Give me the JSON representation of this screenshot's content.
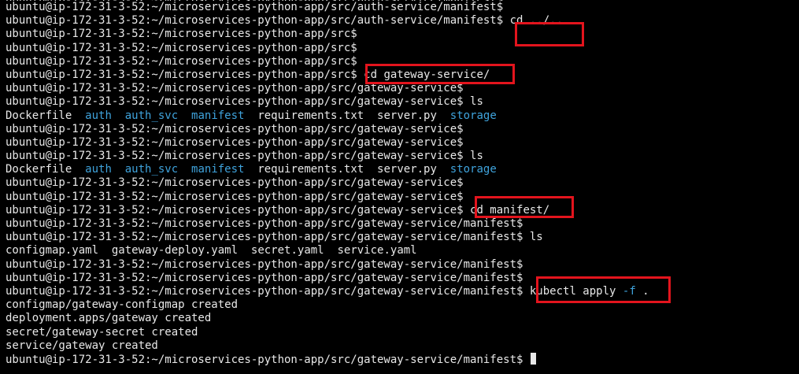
{
  "colors": {
    "background": "#000000",
    "text": "#e8e8e8",
    "directory": "#3fa3dc",
    "highlight": "#e3141d"
  },
  "terminal": {
    "lines": [
      {
        "segments": [
          {
            "t": "ubuntu@ip-172-31-3-52:~/microservices-python-app/src/auth-service/manifest$"
          }
        ],
        "clipped": true
      },
      {
        "segments": [
          {
            "t": "ubuntu@ip-172-31-3-52:~/microservices-python-app/src/auth-service/manifest$"
          }
        ]
      },
      {
        "segments": [
          {
            "t": "ubuntu@ip-172-31-3-52:~/microservices-python-app/src/auth-service/manifest$ "
          },
          {
            "t": "cd ../..",
            "cmd": true
          }
        ]
      },
      {
        "segments": [
          {
            "t": "ubuntu@ip-172-31-3-52:~/microservices-python-app/src$"
          }
        ]
      },
      {
        "segments": [
          {
            "t": "ubuntu@ip-172-31-3-52:~/microservices-python-app/src$"
          }
        ]
      },
      {
        "segments": [
          {
            "t": "ubuntu@ip-172-31-3-52:~/microservices-python-app/src$"
          }
        ]
      },
      {
        "segments": [
          {
            "t": "ubuntu@ip-172-31-3-52:~/microservices-python-app/src$ "
          },
          {
            "t": "cd gateway-service/",
            "cmd": true
          }
        ]
      },
      {
        "segments": [
          {
            "t": "ubuntu@ip-172-31-3-52:~/microservices-python-app/src/gateway-service$"
          }
        ]
      },
      {
        "segments": [
          {
            "t": "ubuntu@ip-172-31-3-52:~/microservices-python-app/src/gateway-service$ ls"
          }
        ]
      },
      {
        "listing": true,
        "items": [
          {
            "t": "Dockerfile"
          },
          {
            "t": "auth",
            "dir": true
          },
          {
            "t": "auth_svc",
            "dir": true
          },
          {
            "t": "manifest",
            "dir": true
          },
          {
            "t": "requirements.txt"
          },
          {
            "t": "server.py"
          },
          {
            "t": "storage",
            "dir": true
          }
        ]
      },
      {
        "segments": [
          {
            "t": "ubuntu@ip-172-31-3-52:~/microservices-python-app/src/gateway-service$"
          }
        ]
      },
      {
        "segments": [
          {
            "t": "ubuntu@ip-172-31-3-52:~/microservices-python-app/src/gateway-service$"
          }
        ]
      },
      {
        "segments": [
          {
            "t": "ubuntu@ip-172-31-3-52:~/microservices-python-app/src/gateway-service$ ls"
          }
        ]
      },
      {
        "listing": true,
        "items": [
          {
            "t": "Dockerfile"
          },
          {
            "t": "auth",
            "dir": true
          },
          {
            "t": "auth_svc",
            "dir": true
          },
          {
            "t": "manifest",
            "dir": true
          },
          {
            "t": "requirements.txt"
          },
          {
            "t": "server.py"
          },
          {
            "t": "storage",
            "dir": true
          }
        ]
      },
      {
        "segments": [
          {
            "t": "ubuntu@ip-172-31-3-52:~/microservices-python-app/src/gateway-service$"
          }
        ]
      },
      {
        "segments": [
          {
            "t": "ubuntu@ip-172-31-3-52:~/microservices-python-app/src/gateway-service$"
          }
        ]
      },
      {
        "segments": [
          {
            "t": "ubuntu@ip-172-31-3-52:~/microservices-python-app/src/gateway-service$ "
          },
          {
            "t": "cd manifest/",
            "cmd": true
          }
        ]
      },
      {
        "segments": [
          {
            "t": "ubuntu@ip-172-31-3-52:~/microservices-python-app/src/gateway-service/manifest$"
          }
        ]
      },
      {
        "segments": [
          {
            "t": "ubuntu@ip-172-31-3-52:~/microservices-python-app/src/gateway-service/manifest$ ls"
          }
        ]
      },
      {
        "listing": true,
        "items": [
          {
            "t": "configmap.yaml"
          },
          {
            "t": "gateway-deploy.yaml"
          },
          {
            "t": "secret.yaml"
          },
          {
            "t": "service.yaml"
          }
        ],
        "tight": true
      },
      {
        "segments": [
          {
            "t": "ubuntu@ip-172-31-3-52:~/microservices-python-app/src/gateway-service/manifest$"
          }
        ]
      },
      {
        "segments": [
          {
            "t": "ubuntu@ip-172-31-3-52:~/microservices-python-app/src/gateway-service/manifest$"
          }
        ]
      },
      {
        "segments": [
          {
            "t": "ubuntu@ip-172-31-3-52:~/microservices-python-app/src/gateway-service/manifest$ "
          },
          {
            "t": "kubectl apply ",
            "cmd": true
          },
          {
            "t": "-f",
            "cmd": true,
            "flag": true
          },
          {
            "t": " .",
            "cmd": true
          }
        ]
      },
      {
        "segments": [
          {
            "t": "configmap/gateway-configmap created"
          }
        ]
      },
      {
        "segments": [
          {
            "t": "deployment.apps/gateway created"
          }
        ]
      },
      {
        "segments": [
          {
            "t": "secret/gateway-secret created"
          }
        ]
      },
      {
        "segments": [
          {
            "t": "service/gateway created"
          }
        ]
      },
      {
        "segments": [
          {
            "t": "ubuntu@ip-172-31-3-52:~/microservices-python-app/src/gateway-service/manifest$ "
          }
        ],
        "cursor": true
      }
    ]
  }
}
